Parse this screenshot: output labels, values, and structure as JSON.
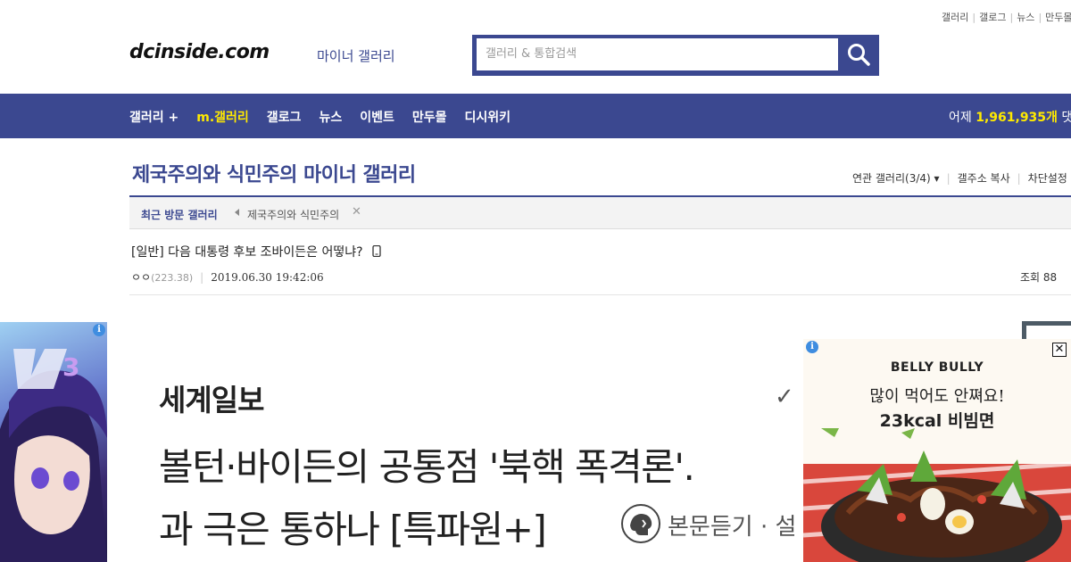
{
  "util_links": [
    "갤러리",
    "갤로그",
    "뉴스",
    "만두몰"
  ],
  "header": {
    "logo": "dcinside.com",
    "logo_sub": "마이너 갤러리",
    "search_placeholder": "갤러리 & 통합검색"
  },
  "nav": {
    "items": [
      "갤러리 +",
      "m.갤러리",
      "갤로그",
      "뉴스",
      "이벤트",
      "만두몰",
      "디시위키"
    ],
    "stats_prefix": "어제",
    "stats_number": "1,961,935개",
    "stats_suffix": "댓글"
  },
  "gallery": {
    "title": "제국주의와 식민주의 마이너 갤러리",
    "tools": [
      "연관 갤러리(3/4)",
      "갤주소 복사",
      "차단설정"
    ],
    "recent_label": "최근 방문 갤러리",
    "recent_item": "제국주의와 식민주의"
  },
  "post": {
    "title": "[일반] 다음 대통령 후보 조바이든은 어떻냐?",
    "author": "ㅇㅇ",
    "ip": "(223.38)",
    "date": "2019.06.30 19:42:06",
    "views": "조회 88"
  },
  "article": {
    "brand": "세계일보",
    "headline_1": "볼턴·바이든의 공통점 '북핵 폭격론'.",
    "headline_2": "과 극은 통하나 [특파원+]",
    "listen": "본문듣기 · 설"
  },
  "ad_right": {
    "brand": "BELLY BULLY",
    "line1": "많이 먹어도 안쪄요!",
    "line2": "23kcal 비빔면"
  },
  "colors": {
    "brand_blue": "#3b4890",
    "highlight_yellow": "#ffea00"
  }
}
